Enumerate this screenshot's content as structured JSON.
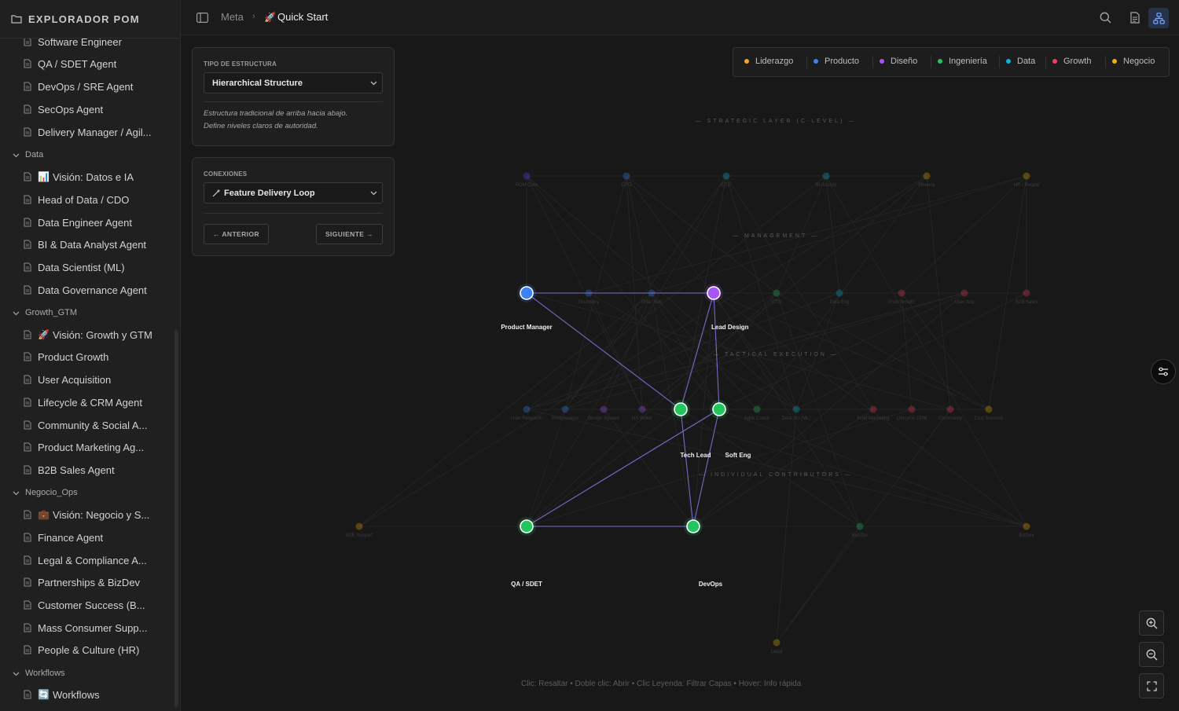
{
  "sidebar": {
    "title": "EXPLORADOR POM",
    "items": [
      {
        "kind": "file",
        "label": "Software Engineer"
      },
      {
        "kind": "file",
        "label": "QA / SDET Agent"
      },
      {
        "kind": "file",
        "label": "DevOps / SRE Agent"
      },
      {
        "kind": "file",
        "label": "SecOps Agent"
      },
      {
        "kind": "file",
        "label": "Delivery Manager / Agil..."
      },
      {
        "kind": "folder",
        "label": "Data"
      },
      {
        "kind": "file",
        "label": "Visión: Datos e IA",
        "emoji": "📊"
      },
      {
        "kind": "file",
        "label": "Head of Data / CDO"
      },
      {
        "kind": "file",
        "label": "Data Engineer Agent"
      },
      {
        "kind": "file",
        "label": "BI & Data Analyst Agent"
      },
      {
        "kind": "file",
        "label": "Data Scientist (ML)"
      },
      {
        "kind": "file",
        "label": "Data Governance Agent"
      },
      {
        "kind": "folder",
        "label": "Growth_GTM"
      },
      {
        "kind": "file",
        "label": "Visión: Growth y GTM",
        "emoji": "🚀"
      },
      {
        "kind": "file",
        "label": "Product Growth"
      },
      {
        "kind": "file",
        "label": "User Acquisition"
      },
      {
        "kind": "file",
        "label": "Lifecycle & CRM Agent"
      },
      {
        "kind": "file",
        "label": "Community & Social A..."
      },
      {
        "kind": "file",
        "label": "Product Marketing Ag..."
      },
      {
        "kind": "file",
        "label": "B2B Sales Agent"
      },
      {
        "kind": "folder",
        "label": "Negocio_Ops"
      },
      {
        "kind": "file",
        "label": "Visión: Negocio y S...",
        "emoji": "💼"
      },
      {
        "kind": "file",
        "label": "Finance Agent"
      },
      {
        "kind": "file",
        "label": "Legal & Compliance A..."
      },
      {
        "kind": "file",
        "label": "Partnerships & BizDev"
      },
      {
        "kind": "file",
        "label": "Customer Success (B..."
      },
      {
        "kind": "file",
        "label": "Mass Consumer Supp..."
      },
      {
        "kind": "file",
        "label": "People & Culture (HR)"
      },
      {
        "kind": "folder",
        "label": "Workflows"
      },
      {
        "kind": "file",
        "label": "Workflows",
        "emoji": "🔄"
      }
    ]
  },
  "topbar": {
    "crumb_parent": "Meta",
    "crumb_current": "Quick Start",
    "crumb_emoji": "🚀",
    "icons": [
      "sidebar-toggle-icon",
      "search-icon",
      "document-icon",
      "graph-view-icon"
    ]
  },
  "structure_panel": {
    "label": "TIPO DE ESTRUCTURA",
    "selected": "Hierarchical Structure",
    "description_line1": "Estructura tradicional de arriba hacia abajo.",
    "description_line2": "Define niveles claros de autoridad."
  },
  "connections_panel": {
    "label": "CONEXIONES",
    "selected": "Feature Delivery Loop",
    "prev_label": "← ANTERIOR",
    "next_label": "SIGUIENTE →"
  },
  "legend": [
    {
      "label": "Liderazgo",
      "color": "#f5a623"
    },
    {
      "label": "Producto",
      "color": "#3b82f6"
    },
    {
      "label": "Diseño",
      "color": "#a855f7"
    },
    {
      "label": "Ingeniería",
      "color": "#22c55e"
    },
    {
      "label": "Data",
      "color": "#06b6d4"
    },
    {
      "label": "Growth",
      "color": "#f43f5e"
    },
    {
      "label": "Negocio",
      "color": "#eab308"
    }
  ],
  "graph": {
    "layers": [
      "— STRATEGIC LAYER (C-LEVEL) —",
      "— MANAGEMENT —",
      "— TACTICAL EXECUTION —",
      "— INDIVIDUAL CONTRIBUTORS —"
    ],
    "highlighted_nodes": [
      {
        "id": "pm",
        "label": "Product Manager",
        "color": "#3b82f6"
      },
      {
        "id": "lead-design",
        "label": "Lead Design",
        "color": "#a855f7"
      },
      {
        "id": "tech-lead",
        "label": "Tech Lead",
        "color": "#22c55e"
      },
      {
        "id": "soft-eng",
        "label": "Soft Eng",
        "color": "#22c55e"
      },
      {
        "id": "qa",
        "label": "QA / SDET",
        "color": "#22c55e"
      },
      {
        "id": "devops",
        "label": "DevOps",
        "color": "#22c55e"
      }
    ],
    "ghost_nodes": [
      {
        "label": "POM Core",
        "color": "#7c3aed"
      },
      {
        "label": "CPO",
        "color": "#3b82f6"
      },
      {
        "label": "CTO",
        "color": "#06b6d4"
      },
      {
        "label": "BI Analyst",
        "color": "#06b6d4"
      },
      {
        "label": "Finance",
        "color": "#eab308"
      },
      {
        "label": "HR / People",
        "color": "#eab308"
      },
      {
        "label": "Discovery",
        "color": "#3b82f6"
      },
      {
        "label": "Pillar Sub",
        "color": "#3b82f6"
      },
      {
        "label": "CTO",
        "color": "#22c55e"
      },
      {
        "label": "Data Eng",
        "color": "#06b6d4"
      },
      {
        "label": "Prod Growth",
        "color": "#f43f5e"
      },
      {
        "label": "User Acq",
        "color": "#f43f5e"
      },
      {
        "label": "B2B Sales",
        "color": "#f43f5e"
      },
      {
        "label": "User Research",
        "color": "#3b82f6"
      },
      {
        "label": "Prod Analyst",
        "color": "#3b82f6"
      },
      {
        "label": "Design System",
        "color": "#a855f7"
      },
      {
        "label": "UX Writer",
        "color": "#a855f7"
      },
      {
        "label": "Agile Coach",
        "color": "#22c55e"
      },
      {
        "label": "Data Sci (ML)",
        "color": "#06b6d4"
      },
      {
        "label": "Prod Marketing",
        "color": "#f43f5e"
      },
      {
        "label": "Lifecycle CRM",
        "color": "#f43f5e"
      },
      {
        "label": "Community",
        "color": "#f43f5e"
      },
      {
        "label": "Cust Success",
        "color": "#eab308"
      },
      {
        "label": "B2B Support",
        "color": "#eab308"
      },
      {
        "label": "SecOps",
        "color": "#22c55e"
      },
      {
        "label": "BizDev",
        "color": "#eab308"
      },
      {
        "label": "Legal",
        "color": "#eab308"
      }
    ]
  },
  "hint": "Clic: Resaltar • Doble clic: Abrir • Clic Leyenda: Filtrar Capas • Hover: Info rápida",
  "zoom": [
    "zoom-in-icon",
    "zoom-out-icon",
    "fullscreen-icon"
  ]
}
